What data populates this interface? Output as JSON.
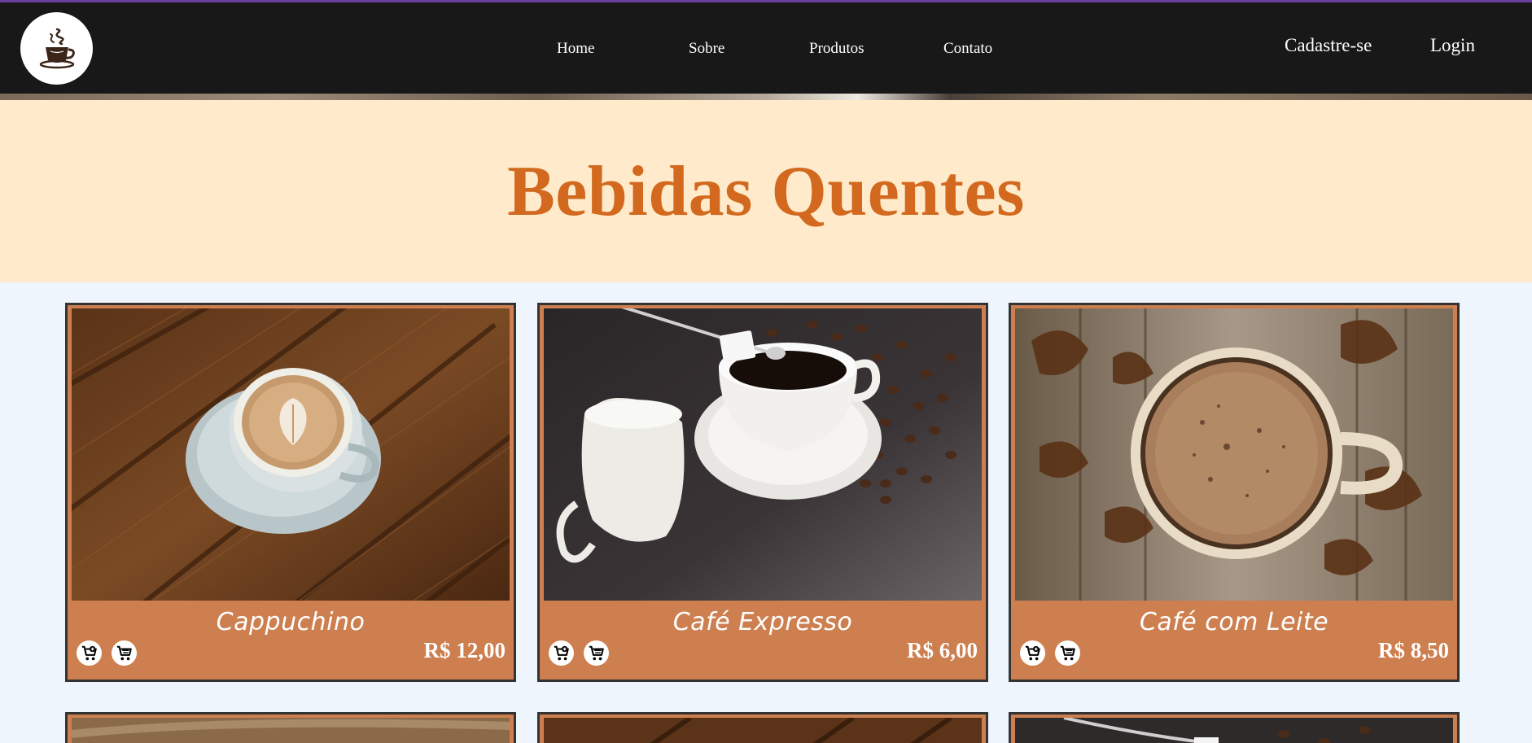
{
  "nav": {
    "logo_alt": "coffee-cup-logo",
    "links": [
      "Home",
      "Sobre",
      "Produtos",
      "Contato"
    ],
    "signup": "Cadastre-se",
    "login": "Login"
  },
  "hero": {
    "title": "Bebidas Quentes"
  },
  "products": [
    {
      "name": "Cappuchino",
      "price": "R$ 12,00"
    },
    {
      "name": "Café Expresso",
      "price": "R$ 6,00"
    },
    {
      "name": "Café com Leite",
      "price": "R$ 8,50"
    }
  ],
  "icons": {
    "add_to_cart": "cart-plus-icon",
    "cart": "cart-icon"
  },
  "colors": {
    "navbar": "#181818",
    "hero_bg": "#ffeacb",
    "title": "#d2691e",
    "card": "#cd7f4f",
    "page_bg": "#eef5fc",
    "accent_line": "#6b3fa0"
  }
}
